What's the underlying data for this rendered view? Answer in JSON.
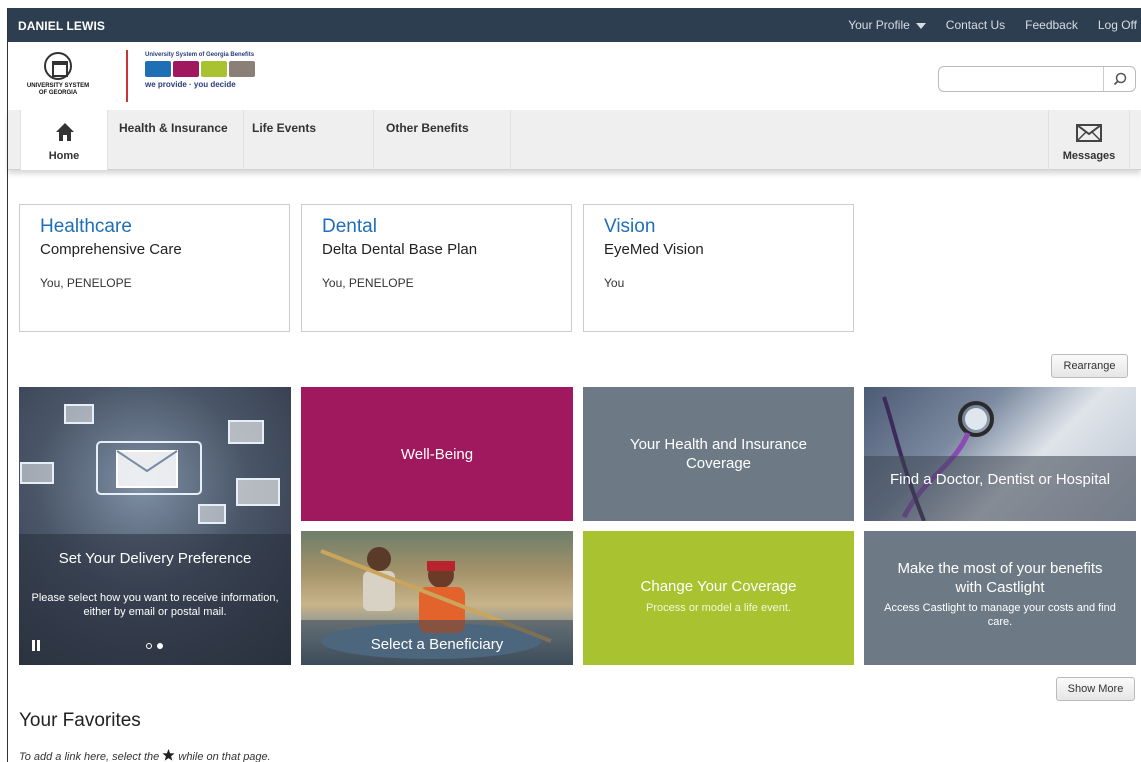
{
  "topbar": {
    "user_name": "DANIEL LEWIS",
    "links": [
      "Your Profile",
      "Contact Us",
      "Feedback",
      "Log Off"
    ]
  },
  "header": {
    "org_logo_text": "UNIVERSITY SYSTEM OF GEORGIA",
    "benefits_logo_title": "University System of Georgia Benefits",
    "benefits_logo_tagline": "we provide · you decide",
    "search_placeholder": ""
  },
  "nav": {
    "home": "Home",
    "tabs": [
      "Health & Insurance",
      "Life Events",
      "Other Benefits"
    ],
    "messages": "Messages"
  },
  "plans": [
    {
      "title": "Healthcare",
      "plan": "Comprehensive Care",
      "members": "You, PENELOPE"
    },
    {
      "title": "Dental",
      "plan": "Delta Dental Base Plan",
      "members": "You, PENELOPE"
    },
    {
      "title": "Vision",
      "plan": "EyeMed Vision",
      "members": "You"
    }
  ],
  "rearrange_label": "Rearrange",
  "tiles": {
    "delivery": {
      "title": "Set Your Delivery Preference",
      "desc": "Please select how you want to receive information, either by email or postal mail."
    },
    "wellbeing": {
      "title": "Well-Being",
      "color": "#a0195e"
    },
    "coverage": {
      "title": "Your Health and Insurance Coverage",
      "color": "#6d7a85"
    },
    "find_doctor": {
      "title": "Find a Doctor, Dentist or Hospital"
    },
    "beneficiary": {
      "title": "Select a Beneficiary"
    },
    "change": {
      "title": "Change Your Coverage",
      "desc": "Process or model a life event.",
      "color": "#a9c22f"
    },
    "castlight": {
      "title": "Make the most of your benefits with Castlight",
      "desc": "Access Castlight to manage your costs and find care.",
      "color": "#6d7a85"
    }
  },
  "show_more_label": "Show More",
  "favorites": {
    "heading": "Your Favorites",
    "hint_before": "To add a link here, select the",
    "hint_after": "while on that page."
  }
}
